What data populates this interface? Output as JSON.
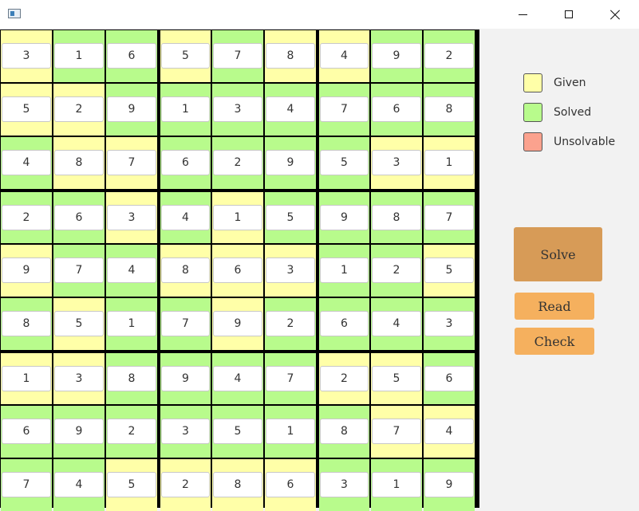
{
  "colors": {
    "given": "#ffffa8",
    "solved": "#b8fb8c",
    "unsolvable": "#fba28e",
    "solve_button": "#d79b57",
    "small_button": "#f5b05e"
  },
  "legend": [
    {
      "label": "Given",
      "status": "given"
    },
    {
      "label": "Solved",
      "status": "solved"
    },
    {
      "label": "Unsolvable",
      "status": "unsolvable"
    }
  ],
  "buttons": {
    "solve": "Solve",
    "read": "Read",
    "check": "Check"
  },
  "grid": {
    "values": [
      [
        "3",
        "1",
        "6",
        "5",
        "7",
        "8",
        "4",
        "9",
        "2"
      ],
      [
        "5",
        "2",
        "9",
        "1",
        "3",
        "4",
        "7",
        "6",
        "8"
      ],
      [
        "4",
        "8",
        "7",
        "6",
        "2",
        "9",
        "5",
        "3",
        "1"
      ],
      [
        "2",
        "6",
        "3",
        "4",
        "1",
        "5",
        "9",
        "8",
        "7"
      ],
      [
        "9",
        "7",
        "4",
        "8",
        "6",
        "3",
        "1",
        "2",
        "5"
      ],
      [
        "8",
        "5",
        "1",
        "7",
        "9",
        "2",
        "6",
        "4",
        "3"
      ],
      [
        "1",
        "3",
        "8",
        "9",
        "4",
        "7",
        "2",
        "5",
        "6"
      ],
      [
        "6",
        "9",
        "2",
        "3",
        "5",
        "1",
        "8",
        "7",
        "4"
      ],
      [
        "7",
        "4",
        "5",
        "2",
        "8",
        "6",
        "3",
        "1",
        "9"
      ]
    ],
    "status": [
      [
        "given",
        "solved",
        "solved",
        "given",
        "solved",
        "given",
        "given",
        "solved",
        "solved"
      ],
      [
        "given",
        "given",
        "solved",
        "solved",
        "solved",
        "solved",
        "solved",
        "solved",
        "solved"
      ],
      [
        "solved",
        "given",
        "given",
        "solved",
        "solved",
        "solved",
        "solved",
        "given",
        "given"
      ],
      [
        "solved",
        "solved",
        "given",
        "solved",
        "given",
        "solved",
        "solved",
        "solved",
        "solved"
      ],
      [
        "given",
        "solved",
        "solved",
        "given",
        "given",
        "given",
        "solved",
        "solved",
        "given"
      ],
      [
        "solved",
        "given",
        "solved",
        "solved",
        "given",
        "solved",
        "solved",
        "solved",
        "solved"
      ],
      [
        "given",
        "given",
        "solved",
        "solved",
        "solved",
        "solved",
        "given",
        "given",
        "solved"
      ],
      [
        "solved",
        "solved",
        "solved",
        "solved",
        "solved",
        "solved",
        "solved",
        "given",
        "given"
      ],
      [
        "solved",
        "solved",
        "given",
        "given",
        "given",
        "given",
        "solved",
        "solved",
        "solved"
      ]
    ]
  }
}
